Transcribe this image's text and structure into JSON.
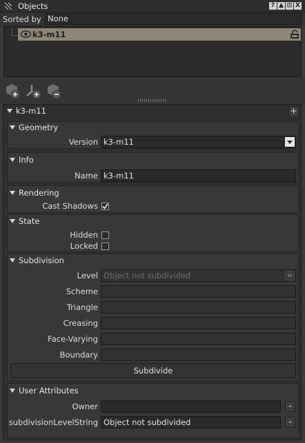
{
  "window": {
    "title": "Objects",
    "controls": [
      "?",
      "▲",
      "⊡",
      "X"
    ]
  },
  "sort": {
    "label": "Sorted by",
    "value": "None"
  },
  "tree": {
    "item_label": "k3-m11"
  },
  "toolbar": {
    "icons": [
      "add-object-icon",
      "add-locator-icon",
      "remove-object-icon"
    ]
  },
  "inspector": {
    "object_name": "k3-m11",
    "add_label": "+",
    "geometry": {
      "title": "Geometry",
      "version_label": "Version",
      "version_value": "k3-m11"
    },
    "info": {
      "title": "Info",
      "name_label": "Name",
      "name_value": "k3-m11"
    },
    "rendering": {
      "title": "Rendering",
      "cast_shadows_label": "Cast Shadows",
      "cast_shadows_checked": true
    },
    "state": {
      "title": "State",
      "hidden_label": "Hidden",
      "locked_label": "Locked"
    },
    "subdivision": {
      "title": "Subdivision",
      "level_label": "Level",
      "level_placeholder": "Object not subdivided",
      "scheme_label": "Scheme",
      "triangle_label": "Triangle",
      "creasing_label": "Creasing",
      "face_varying_label": "Face-Varying",
      "boundary_label": "Boundary",
      "subdivide_button": "Subdivide"
    },
    "user_attributes": {
      "title": "User Attributes",
      "owner_label": "Owner",
      "owner_value": "",
      "sub_level_string_label": "subdivisionLevelString",
      "sub_level_string_value": "Object not subdivided",
      "remove_label": "-"
    }
  }
}
